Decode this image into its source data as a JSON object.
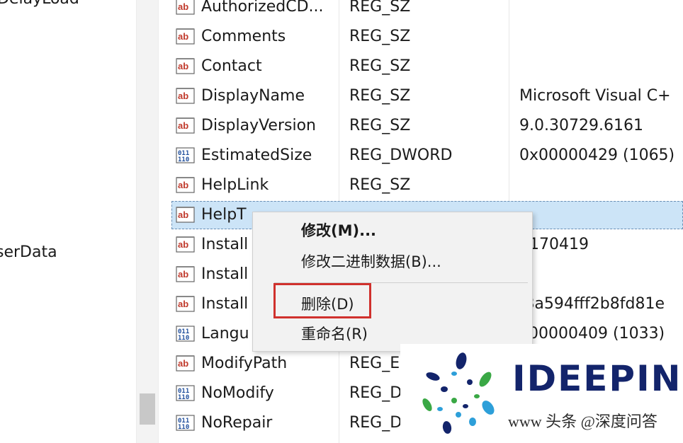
{
  "tree": {
    "items": [
      "DelayLoad",
      "serData"
    ]
  },
  "rows": [
    {
      "icon": "string-value-icon",
      "name": "AuthorizedCD...",
      "type": "REG_SZ",
      "data": ""
    },
    {
      "icon": "string-value-icon",
      "name": "Comments",
      "type": "REG_SZ",
      "data": ""
    },
    {
      "icon": "string-value-icon",
      "name": "Contact",
      "type": "REG_SZ",
      "data": ""
    },
    {
      "icon": "string-value-icon",
      "name": "DisplayName",
      "type": "REG_SZ",
      "data": "Microsoft Visual C+"
    },
    {
      "icon": "string-value-icon",
      "name": "DisplayVersion",
      "type": "REG_SZ",
      "data": "9.0.30729.6161"
    },
    {
      "icon": "binary-value-icon",
      "name": "EstimatedSize",
      "type": "REG_DWORD",
      "data": "0x00000429 (1065)"
    },
    {
      "icon": "string-value-icon",
      "name": "HelpLink",
      "type": "REG_SZ",
      "data": ""
    },
    {
      "icon": "string-value-icon",
      "name": "HelpT",
      "type": "",
      "data": ""
    },
    {
      "icon": "string-value-icon",
      "name": "Install",
      "type": "",
      "data": "0170419"
    },
    {
      "icon": "string-value-icon",
      "name": "Install",
      "type": "",
      "data": ""
    },
    {
      "icon": "string-value-icon",
      "name": "Install",
      "type": "",
      "data": "\\8a594fff2b8fd81e"
    },
    {
      "icon": "binary-value-icon",
      "name": "Langu",
      "type": "",
      "data": "x00000409 (1033)"
    },
    {
      "icon": "string-value-icon",
      "name": "ModifyPath",
      "type": "REG_E",
      "data": ""
    },
    {
      "icon": "binary-value-icon",
      "name": "NoModify",
      "type": "REG_D",
      "data": ""
    },
    {
      "icon": "binary-value-icon",
      "name": "NoRepair",
      "type": "REG_D",
      "data": ""
    }
  ],
  "context_menu": {
    "modify": "修改(M)...",
    "modify_binary": "修改二进制数据(B)...",
    "delete": "删除(D)",
    "rename": "重命名(R)"
  },
  "watermark": {
    "brand": "IDEEPIN",
    "credit": "www 头条 @深度问答"
  },
  "colors": {
    "selection": "#cce4f7",
    "highlight_box": "#d0312d",
    "brand": "#13246b"
  }
}
